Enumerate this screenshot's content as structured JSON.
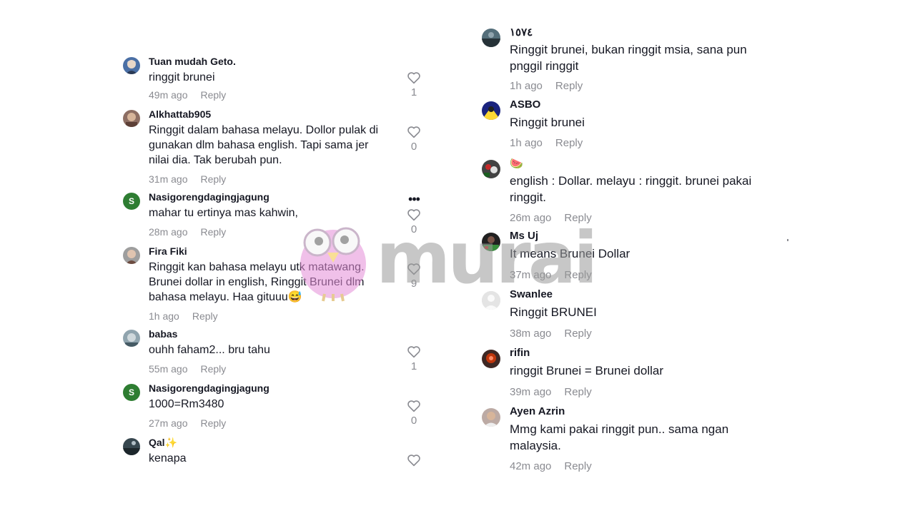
{
  "left_comments": [
    {
      "username": "Tuan mudah Geto.",
      "text": "ringgit brunei",
      "time": "49m ago",
      "reply": "Reply",
      "likes": "1",
      "avatar": "anime-avatar"
    },
    {
      "username": "Alkhattab905",
      "text": "Ringgit dalam bahasa melayu. Dollor pulak di gunakan dlm bahasa english. Tapi sama jer nilai dia. Tak berubah pun.",
      "time": "31m ago",
      "reply": "Reply",
      "likes": "0",
      "avatar": "photo-avatar"
    },
    {
      "username": "Nasigorengdagingjagung",
      "text": "mahar tu ertinya mas kahwin,",
      "time": "28m ago",
      "reply": "Reply",
      "likes": "0",
      "avatar": "letter-avatar",
      "letter": "S",
      "more": "•••"
    },
    {
      "username": "Fira Fiki",
      "text": "Ringgit kan bahasa melayu utk matawang. Brunei dollar in english, Ringgit Brunei dlm bahasa melayu. Haa gituuu😅",
      "time": "1h ago",
      "reply": "Reply",
      "likes": "9",
      "avatar": "photo-avatar"
    },
    {
      "username": "babas",
      "text": "ouhh faham2... bru tahu",
      "time": "55m ago",
      "reply": "Reply",
      "likes": "1",
      "avatar": "photo-avatar"
    },
    {
      "username": "Nasigorengdagingjagung",
      "text": "1000=Rm3480",
      "time": "27m ago",
      "reply": "Reply",
      "likes": "0",
      "avatar": "letter-avatar",
      "letter": "S"
    },
    {
      "username": "Qal✨",
      "text": "kenapa",
      "time": "",
      "reply": "",
      "likes": "",
      "avatar": "photo-avatar"
    }
  ],
  "right_comments": [
    {
      "username": "١٥٧٤",
      "text": "Ringgit brunei, bukan ringgit msia, sana pun pnggil ringgit",
      "time": "1h ago",
      "reply": "Reply",
      "avatar": "photo-avatar"
    },
    {
      "username": "ASBO",
      "text": "Ringgit brunei",
      "time": "1h ago",
      "reply": "Reply",
      "avatar": "photo-avatar"
    },
    {
      "username": "🍉",
      "text": "english : Dollar. melayu : ringgit. brunei pakai ringgit.",
      "time": "26m ago",
      "reply": "Reply",
      "avatar": "photo-avatar"
    },
    {
      "username": "Ms Uj",
      "text": "It means Brunei Dollar",
      "time": "37m ago",
      "reply": "Reply",
      "avatar": "photo-avatar"
    },
    {
      "username": "Swanlee",
      "text": "Ringgit BRUNEI",
      "time": "38m ago",
      "reply": "Reply",
      "avatar": "default-avatar"
    },
    {
      "username": "rifin",
      "text": "ringgit Brunei = Brunei dollar",
      "time": "39m ago",
      "reply": "Reply",
      "avatar": "photo-avatar"
    },
    {
      "username": "Ayen Azrin",
      "text": "Mmg kami pakai ringgit pun.. sama ngan malaysia.",
      "time": "42m ago",
      "reply": "Reply",
      "avatar": "photo-avatar"
    }
  ],
  "watermark": {
    "text": "murai"
  },
  "colors": {
    "meta": "#8a8b91",
    "text": "#161823",
    "letter_avatar": "#2e7d32"
  }
}
